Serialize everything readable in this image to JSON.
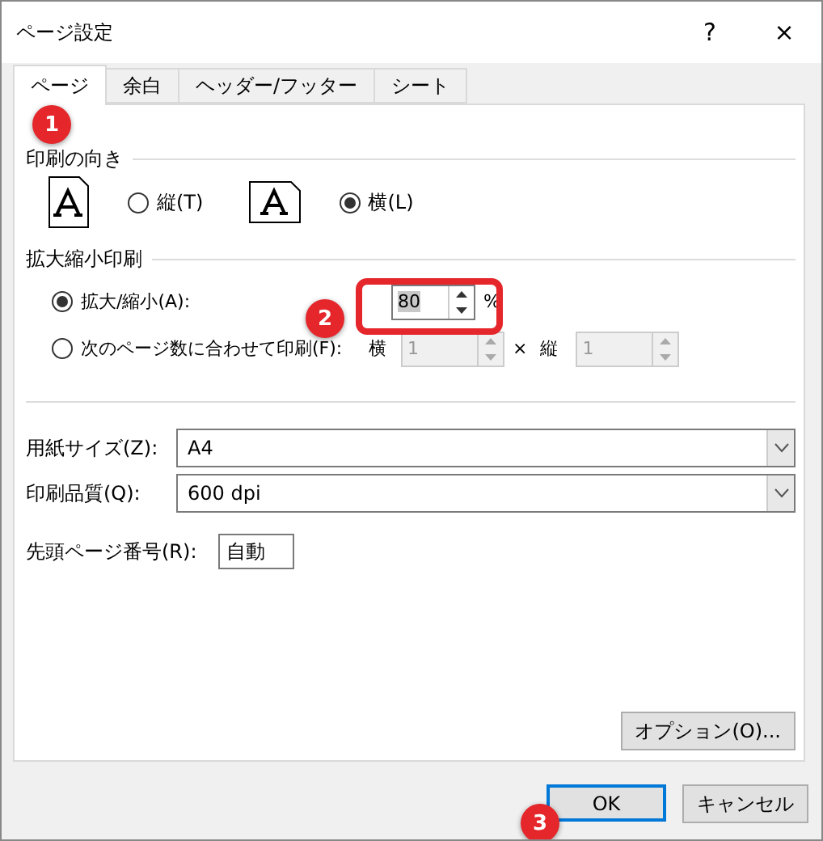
{
  "window": {
    "title": "ページ設定",
    "help": "?",
    "close": "×"
  },
  "tabs": [
    {
      "label": "ページ",
      "selected": true
    },
    {
      "label": "余白",
      "selected": false
    },
    {
      "label": "ヘッダー/フッター",
      "selected": false
    },
    {
      "label": "シート",
      "selected": false
    }
  ],
  "orientation": {
    "title": "印刷の向き",
    "options": [
      {
        "label": "縦(T)",
        "kind": "portrait",
        "selected": false
      },
      {
        "label": "横(L)",
        "kind": "landscape",
        "selected": true
      }
    ]
  },
  "scaling": {
    "title": "拡大縮小印刷",
    "zoom": {
      "label": "拡大/縮小(A):",
      "selected": true,
      "value": "80",
      "unit": "%",
      "disabled": false
    },
    "fit": {
      "label": "次のページ数に合わせて印刷(F):",
      "selected": false,
      "wide_label": "横",
      "wide_value": "1",
      "times": "×",
      "tall_label": "縦",
      "tall_value": "1",
      "disabled": true
    }
  },
  "paper_size": {
    "label": "用紙サイズ(Z):",
    "value": "A4"
  },
  "print_quality": {
    "label": "印刷品質(Q):",
    "value": "600 dpi"
  },
  "first_page_number": {
    "label": "先頭ページ番号(R):",
    "value": "自動"
  },
  "options_button": "オプション(O)...",
  "buttons": [
    {
      "label": "OK",
      "default": true
    },
    {
      "label": "キャンセル",
      "default": false
    }
  ],
  "annotations": [
    {
      "label": "1"
    },
    {
      "label": "2"
    },
    {
      "label": "3"
    }
  ]
}
